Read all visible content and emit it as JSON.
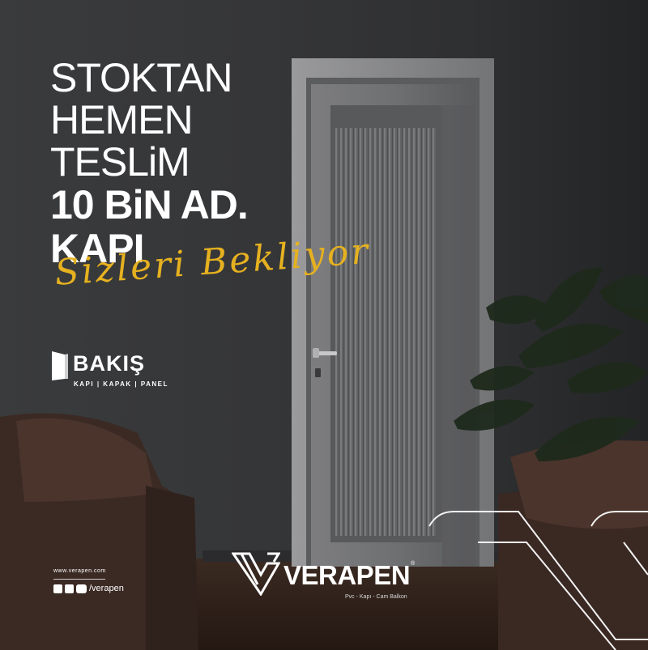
{
  "headline": {
    "line1": "STOKTAN",
    "line2": "HEMEN",
    "line3": "TESLiM",
    "line4": "10 BiN AD.",
    "line5": "KAPI",
    "script": "Sizleri Bekliyor"
  },
  "bakis_logo": {
    "name": "BAKIŞ",
    "tagline": "KAPI | KAPAK | PANEL"
  },
  "contact": {
    "website": "www.verapen.com",
    "social_handle": "/verapen",
    "icons": [
      "facebook-icon",
      "instagram-icon",
      "youtube-icon"
    ]
  },
  "verapen_logo": {
    "name": "VERAPEN",
    "registered": "®",
    "tagline": "Pvc - Kapı - Cam Balkon"
  },
  "colors": {
    "script_gold": "#e6b120",
    "text": "#ffffff",
    "wall": "#353638"
  }
}
